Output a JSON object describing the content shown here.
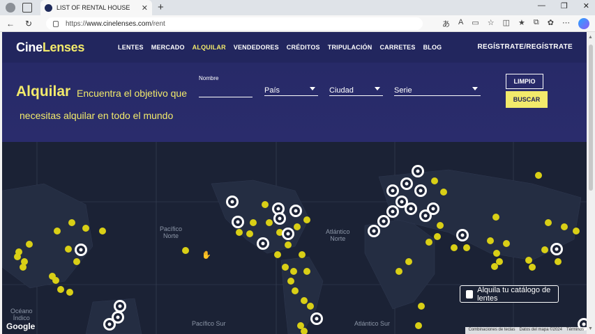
{
  "browser": {
    "tab_title": "LIST OF RENTAL HOUSE",
    "url_prefix": "https://",
    "url_host": "www.cinelenses.com",
    "url_path": "/rent"
  },
  "site": {
    "logo_main": "Cine",
    "logo_accent": "Lenses",
    "menu": [
      "LENTES",
      "MERCADO",
      "ALQUILAR",
      "VENDEDORES",
      "CRÉDITOS",
      "TRIPULACIÓN",
      "CARRETES",
      "BLOG"
    ],
    "active_menu": "ALQUILAR",
    "register": "REGÍSTRATE/REGÍSTRATE"
  },
  "hero": {
    "title": "Alquilar",
    "subtitle_line1": "Encuentra el objetivo que",
    "subtitle_line2": "necesitas alquilar en todo el mundo",
    "name_label": "Nombre",
    "country": "País",
    "city": "Ciudad",
    "series": "Serie",
    "clear_button": "LIMPIO",
    "search_button": "BUSCAR"
  },
  "map": {
    "labels": {
      "pacific_north": "Pacífico\nNorte",
      "atlantic_north": "Atlántico\nNorte",
      "pacific_south": "Pacífico Sur",
      "atlantic_south": "Atlántico Sur",
      "indian_ocean": "Océano\nÍndico"
    },
    "catalog_button": "Alquila tu catálogo de lentes",
    "google": "Google",
    "attribution": [
      "Combinaciones de teclas",
      "Datos del mapa ©2024",
      "Términos"
    ],
    "colors": {
      "dot": "#d9cf16",
      "pin": "#ffffff",
      "land": "#232c40",
      "water": "#1b2235"
    }
  }
}
